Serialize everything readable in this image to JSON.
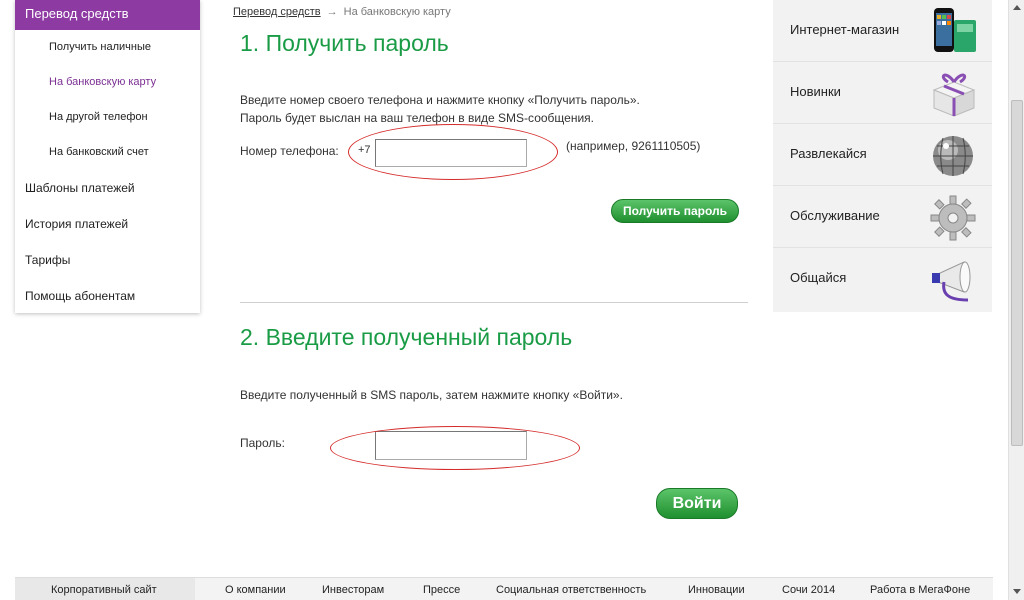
{
  "sidebar": {
    "active": "Перевод средств",
    "sub_items": [
      {
        "label": "Получить наличные"
      },
      {
        "label": "На банковскую карту"
      },
      {
        "label": "На другой телефон"
      },
      {
        "label": "На банковский счет"
      }
    ],
    "items": [
      {
        "label": "Шаблоны платежей"
      },
      {
        "label": "История платежей"
      },
      {
        "label": "Тарифы"
      },
      {
        "label": "Помощь абонентам"
      }
    ]
  },
  "breadcrumb": {
    "parent": "Перевод средств",
    "separator": "→",
    "current": "На банковскую карту"
  },
  "step1": {
    "title": "1. Получить пароль",
    "line1": "Введите номер своего телефона и нажмите кнопку «Получить пароль».",
    "line2": "Пароль будет выслан на ваш телефон в виде SMS-сообщения.",
    "phone_label": "Номер телефона:",
    "phone_prefix": "+7",
    "phone_value": "",
    "phone_hint": "(например, 9261110505)",
    "button": "Получить пароль"
  },
  "step2": {
    "title": "2. Введите полученный пароль",
    "line1": "Введите полученный в SMS пароль, затем нажмите кнопку «Войти».",
    "password_label": "Пароль:",
    "password_value": "",
    "button": "Войти"
  },
  "right_panel": {
    "items": [
      {
        "label": "Интернет-магазин",
        "icon": "phone-icon"
      },
      {
        "label": "Новинки",
        "icon": "gift-icon"
      },
      {
        "label": "Развлекайся",
        "icon": "disco-ball-icon"
      },
      {
        "label": "Обслуживание",
        "icon": "gear-icon"
      },
      {
        "label": "Общайся",
        "icon": "megaphone-icon"
      }
    ]
  },
  "footer": {
    "items": [
      {
        "label": "Корпоративный сайт"
      },
      {
        "label": "О компании"
      },
      {
        "label": "Инвесторам"
      },
      {
        "label": "Прессе"
      },
      {
        "label": "Социальная ответственность"
      },
      {
        "label": "Инновации"
      },
      {
        "label": "Сочи 2014"
      },
      {
        "label": "Работа в МегаФоне"
      }
    ]
  },
  "colors": {
    "accent_purple": "#8d3aa3",
    "heading_green": "#1a9b45",
    "button_green": "#2ea13c",
    "highlight_red": "#d52b2b"
  }
}
